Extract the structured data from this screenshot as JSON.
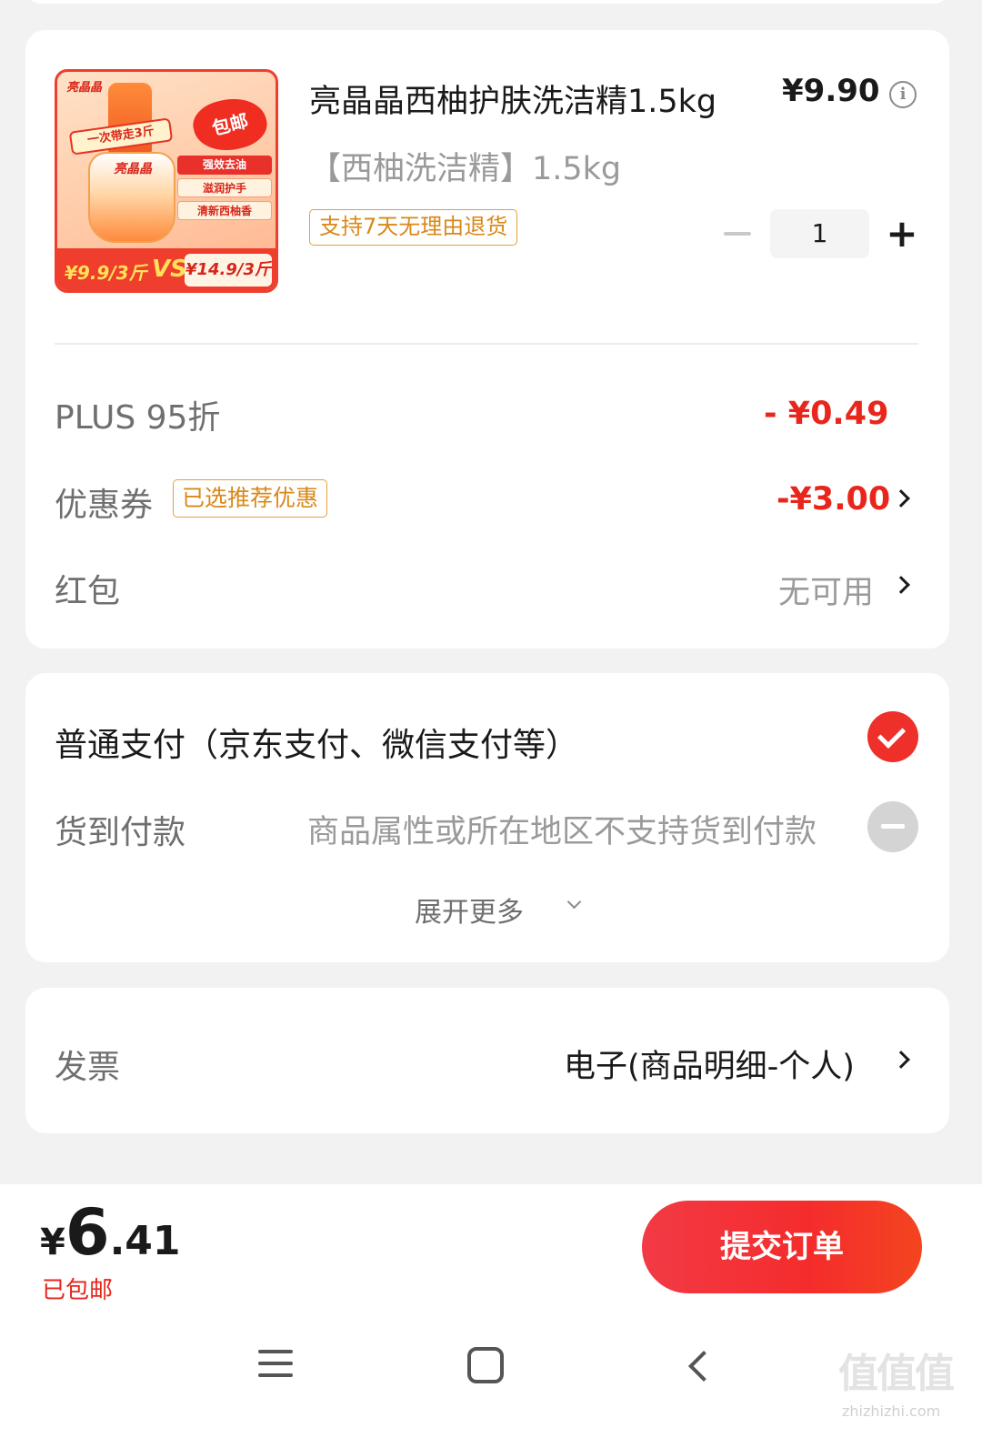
{
  "product": {
    "title": "亮晶晶西柚护肤洗洁精1.5kg",
    "price": "¥9.90",
    "spec": "【西柚洗洁精】1.5kg",
    "return_policy": "支持7天无理由退货",
    "quantity": "1",
    "image": {
      "brand": "亮晶晶",
      "banner": "一次带走3斤",
      "burst": "包邮",
      "bottle_label": "亮晶晶",
      "tags": [
        "强效去油",
        "滋润护手",
        "清新西柚香"
      ],
      "price_left": "¥9.9/3斤",
      "vs": "VS",
      "price_right": "¥14.9/3斤"
    }
  },
  "discounts": {
    "plus_label": "PLUS 95折",
    "plus_value": "- ¥0.49",
    "coupon_label": "优惠券",
    "coupon_badge": "已选推荐优惠",
    "coupon_value": "-¥3.00",
    "hongbao_label": "红包",
    "hongbao_value": "无可用"
  },
  "payment": {
    "normal": "普通支付（京东支付、微信支付等）",
    "cod_label": "货到付款",
    "cod_note": "商品属性或所在地区不支持货到付款",
    "expand_more": "展开更多"
  },
  "invoice": {
    "label": "发票",
    "value": "电子(商品明细-个人)"
  },
  "bottom_bar": {
    "total_yen": "¥",
    "total_int": "6",
    "total_dec": ".41",
    "shipping": "已包邮",
    "submit": "提交订单"
  },
  "watermark": {
    "text": "值值值",
    "url": "zhizhizhi.com"
  },
  "colors": {
    "accent_red": "#e8261c",
    "badge_orange": "#d9881a",
    "background": "#f2f2f2"
  }
}
